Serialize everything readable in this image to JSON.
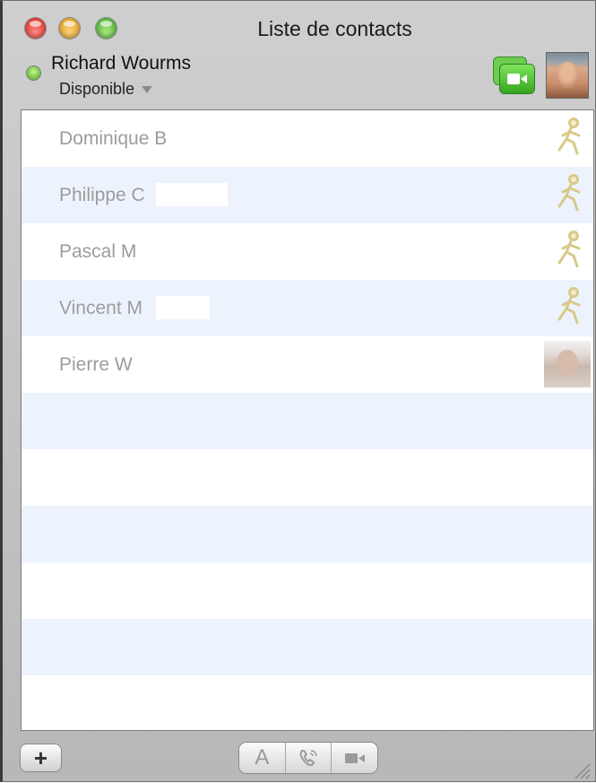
{
  "window": {
    "title": "Liste de contacts",
    "buttons": [
      "close",
      "minimize",
      "zoom"
    ]
  },
  "account": {
    "name": "Richard Wourms",
    "status": "Disponible",
    "status_color": "#41a11c",
    "video_icon": "video-camera-icon",
    "avatar": "user-photo"
  },
  "contacts": [
    {
      "name": "Dominique B",
      "icon": "aim-running-man-icon"
    },
    {
      "name": "Philippe C",
      "icon": "aim-running-man-icon"
    },
    {
      "name": "Pascal M",
      "icon": "aim-running-man-icon"
    },
    {
      "name": "Vincent M",
      "icon": "aim-running-man-icon"
    },
    {
      "name": "Pierre W",
      "icon": "contact-photo"
    }
  ],
  "toolbar": {
    "add_label": "+",
    "text_chat_label": "A",
    "audio_icon": "phone-icon",
    "video_icon": "video-camera-icon"
  },
  "colors": {
    "row_alt": "#edf3fd",
    "contact_text": "#9c9c9c",
    "video_green": "#35a51f"
  }
}
